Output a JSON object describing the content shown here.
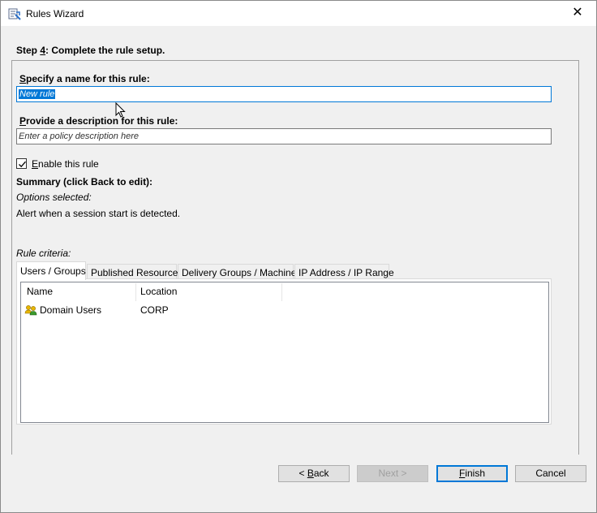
{
  "window": {
    "title": "Rules Wizard",
    "close_glyph": "✕"
  },
  "step": {
    "title_pre": "Step ",
    "title_key": "4",
    "title_post": ": Complete the rule setup."
  },
  "name_field": {
    "label_key": "S",
    "label_rest": "pecify a name for this rule:",
    "value": "New rule"
  },
  "description_field": {
    "label_key": "P",
    "label_rest": "rovide a description for this rule:",
    "placeholder": "Enter a policy description here"
  },
  "enable_checkbox": {
    "label_key": "E",
    "label_rest": "nable this rule",
    "checked": true
  },
  "summary": {
    "heading": "Summary (click Back to edit):",
    "options_label": "Options selected:",
    "option_text": "Alert when a session start is detected.",
    "criteria_label": "Rule criteria:"
  },
  "tabs": [
    {
      "label": "Users / Groups",
      "active": true
    },
    {
      "label": "Published Resources",
      "active": false
    },
    {
      "label": "Delivery Groups / Machines",
      "active": false
    },
    {
      "label": "IP Address / IP Range",
      "active": false
    }
  ],
  "table": {
    "columns": [
      "Name",
      "Location"
    ],
    "rows": [
      {
        "icon": "users-group-icon",
        "name": "Domain Users",
        "location": "CORP"
      }
    ]
  },
  "buttons": {
    "back_pre": "< ",
    "back_key": "B",
    "back_rest": "ack",
    "next": "Next >",
    "finish_key": "F",
    "finish_rest": "inish",
    "cancel": "Cancel"
  },
  "colors": {
    "accent": "#0078d7",
    "background": "#f0f0f0"
  }
}
